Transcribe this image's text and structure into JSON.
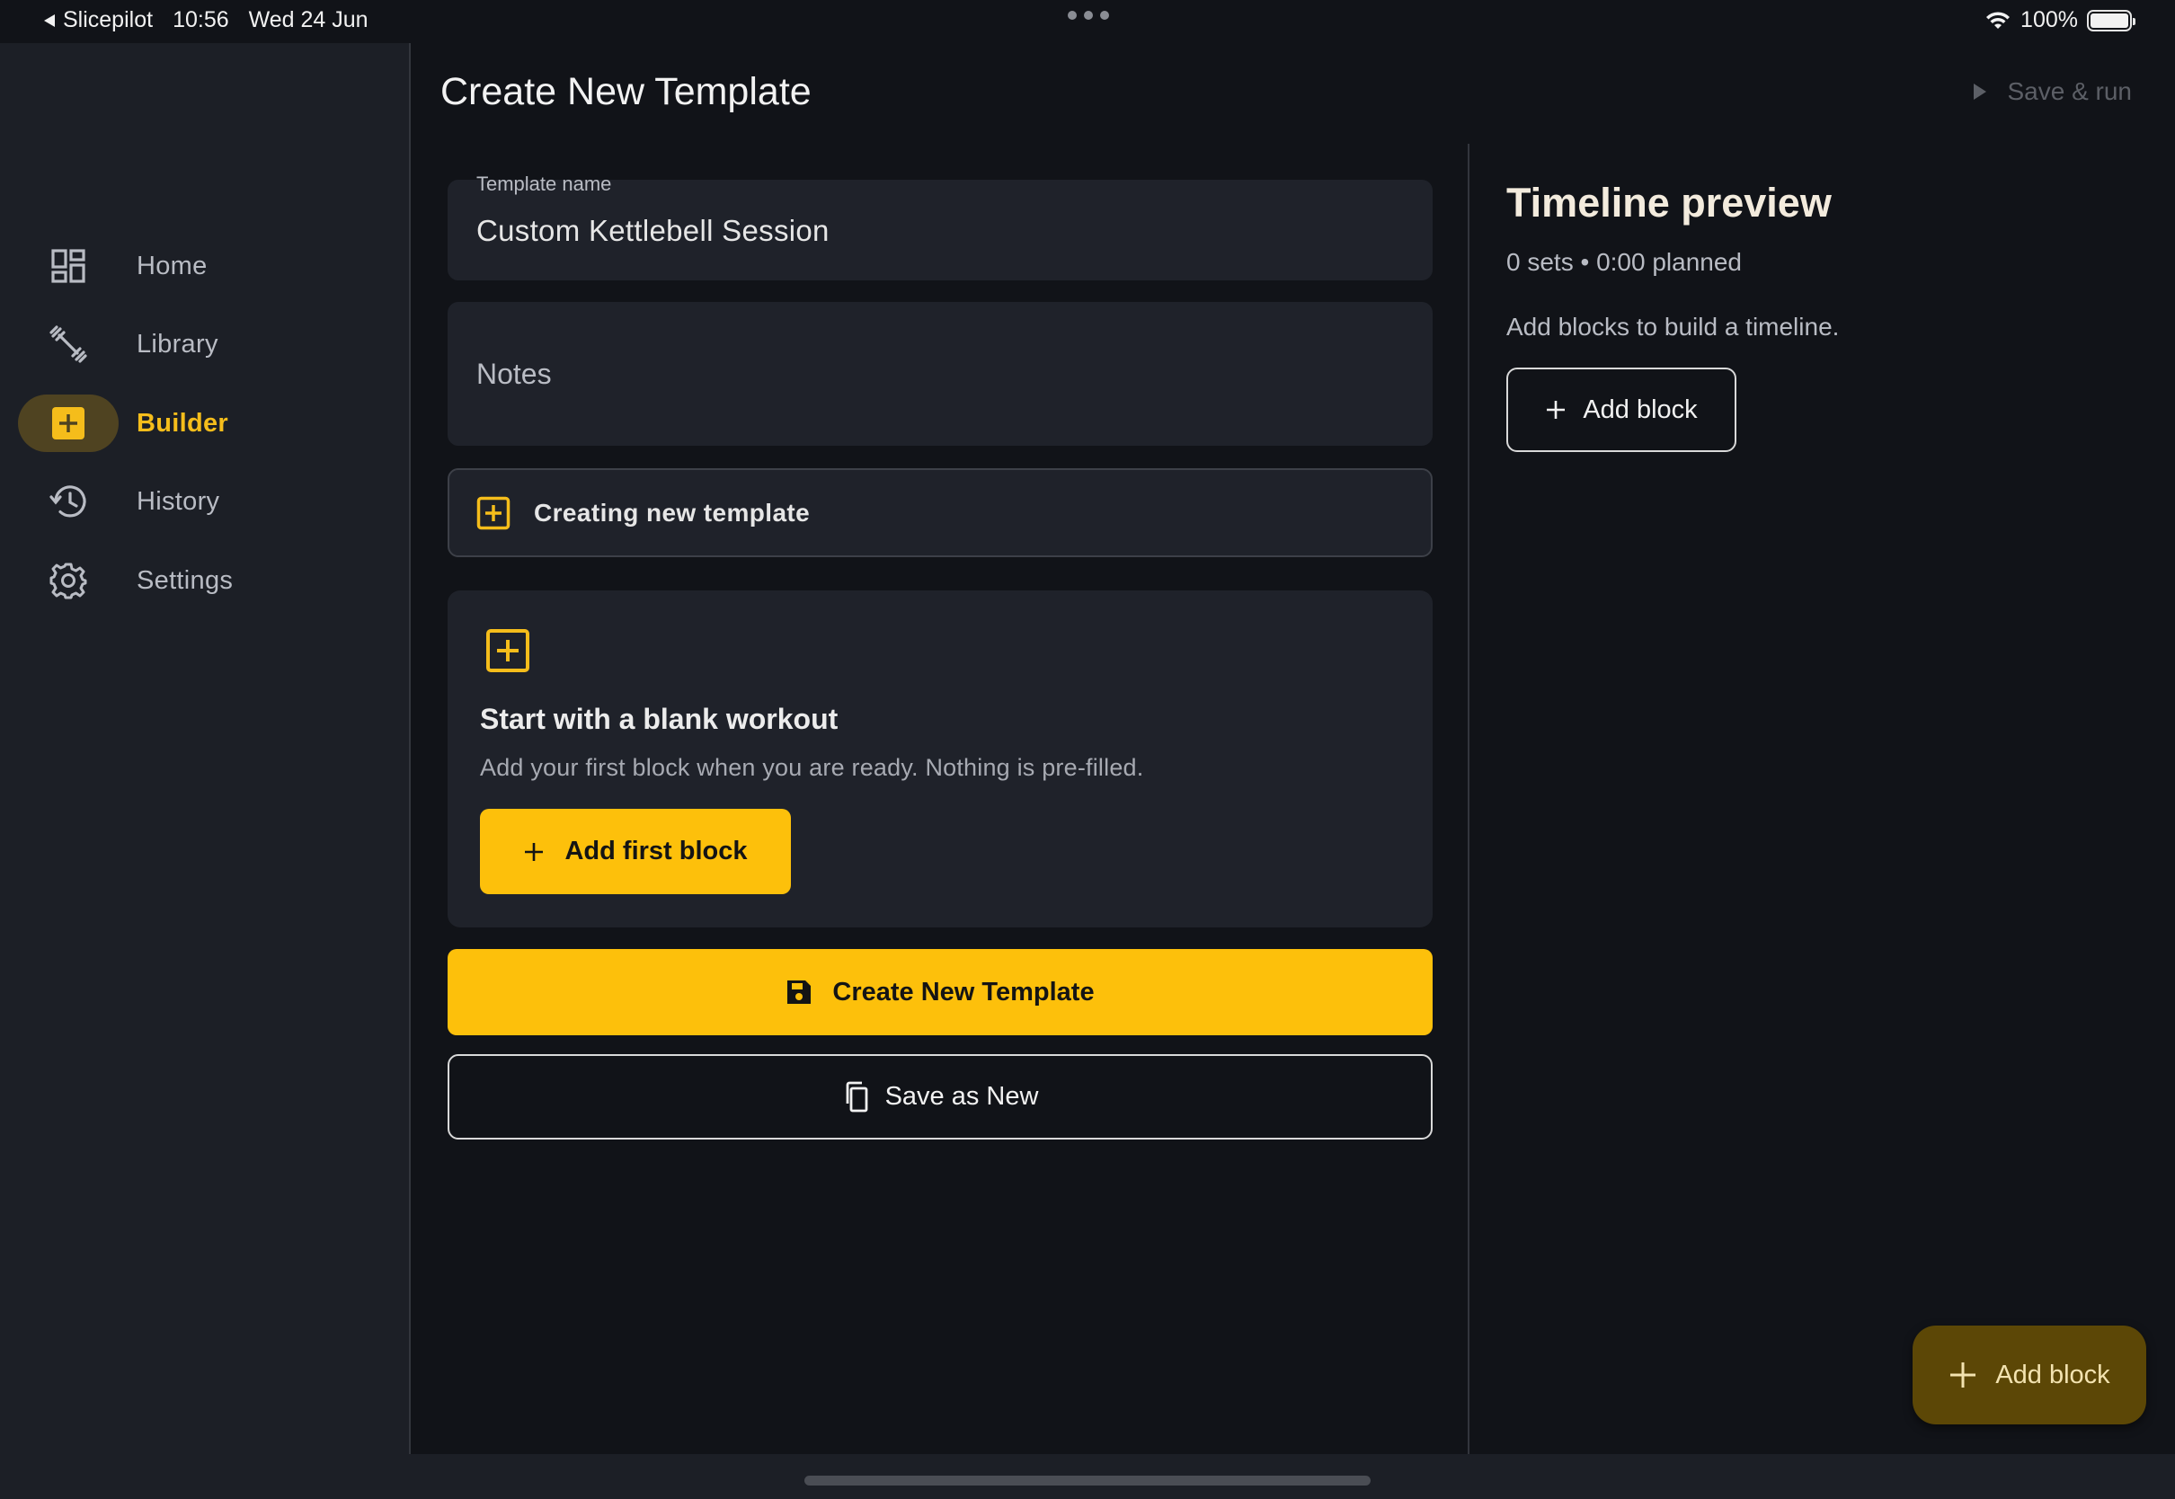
{
  "status_bar": {
    "back_app": "Slicepilot",
    "time": "10:56",
    "date": "Wed 24 Jun",
    "battery": "100%"
  },
  "sidebar": {
    "items": [
      {
        "label": "Home",
        "icon": "dashboard-icon",
        "active": false
      },
      {
        "label": "Library",
        "icon": "dumbbell-icon",
        "active": false
      },
      {
        "label": "Builder",
        "icon": "plus-box-icon",
        "active": true
      },
      {
        "label": "History",
        "icon": "history-icon",
        "active": false
      },
      {
        "label": "Settings",
        "icon": "gear-icon",
        "active": false
      }
    ]
  },
  "header": {
    "title": "Create New Template",
    "save_run_label": "Save & run"
  },
  "form": {
    "template_name_label": "Template name",
    "template_name_value": "Custom Kettlebell Session",
    "notes_placeholder": "Notes",
    "status_text": "Creating new template"
  },
  "blank_card": {
    "title": "Start with a blank workout",
    "subtitle": "Add your first block when you are ready. Nothing is pre-filled.",
    "add_first_block_label": "Add first block"
  },
  "actions": {
    "create_label": "Create New Template",
    "save_as_new_label": "Save as New"
  },
  "timeline": {
    "title": "Timeline preview",
    "meta": "0 sets • 0:00 planned",
    "empty_text": "Add blocks to build a timeline.",
    "add_block_label": "Add block"
  },
  "fab": {
    "label": "Add block"
  },
  "colors": {
    "accent": "#fdc00b",
    "background": "#111318",
    "surface": "#1f222a",
    "sidebar": "#1c1f26"
  }
}
